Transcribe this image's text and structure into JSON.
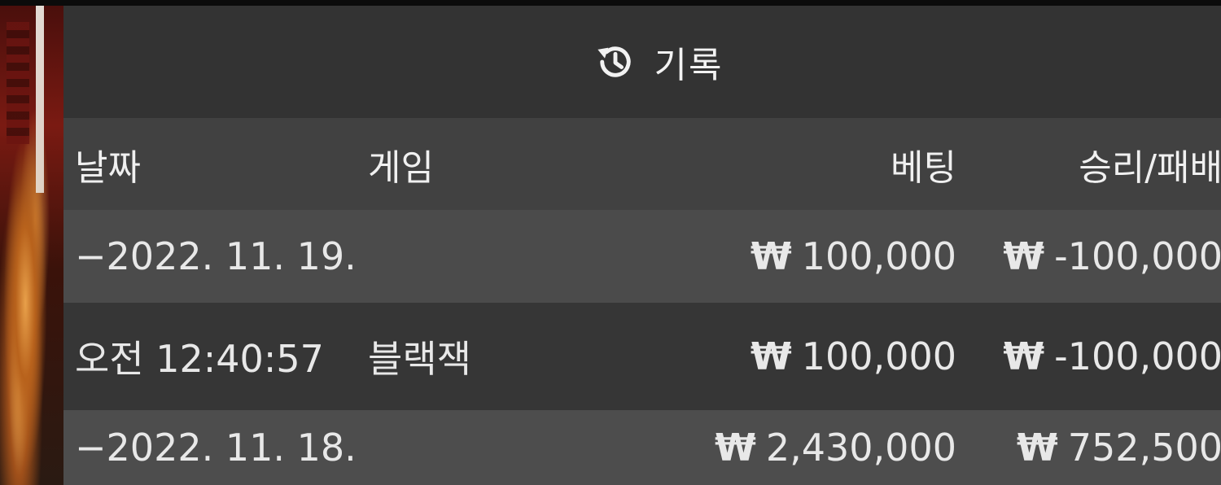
{
  "header": {
    "title": "기록",
    "icon": "history-icon"
  },
  "columns": {
    "date": "날짜",
    "game": "게임",
    "bet": "베팅",
    "win_loss": "승리/패배"
  },
  "currency_symbol": "₩",
  "rows": [
    {
      "type": "date",
      "date": "−2022. 11. 19.",
      "game": "",
      "bet": "100,000",
      "win_loss": "-100,000"
    },
    {
      "type": "game",
      "date": "오전 12:40:57",
      "game": "블랙잭",
      "bet": "100,000",
      "win_loss": "-100,000"
    },
    {
      "type": "date",
      "date": "−2022. 11. 18.",
      "game": "",
      "bet": "2,430,000",
      "win_loss": "752,500"
    }
  ],
  "colors": {
    "panel": "#3a3a3a",
    "header": "#333333",
    "text": "#e8e8e8"
  }
}
